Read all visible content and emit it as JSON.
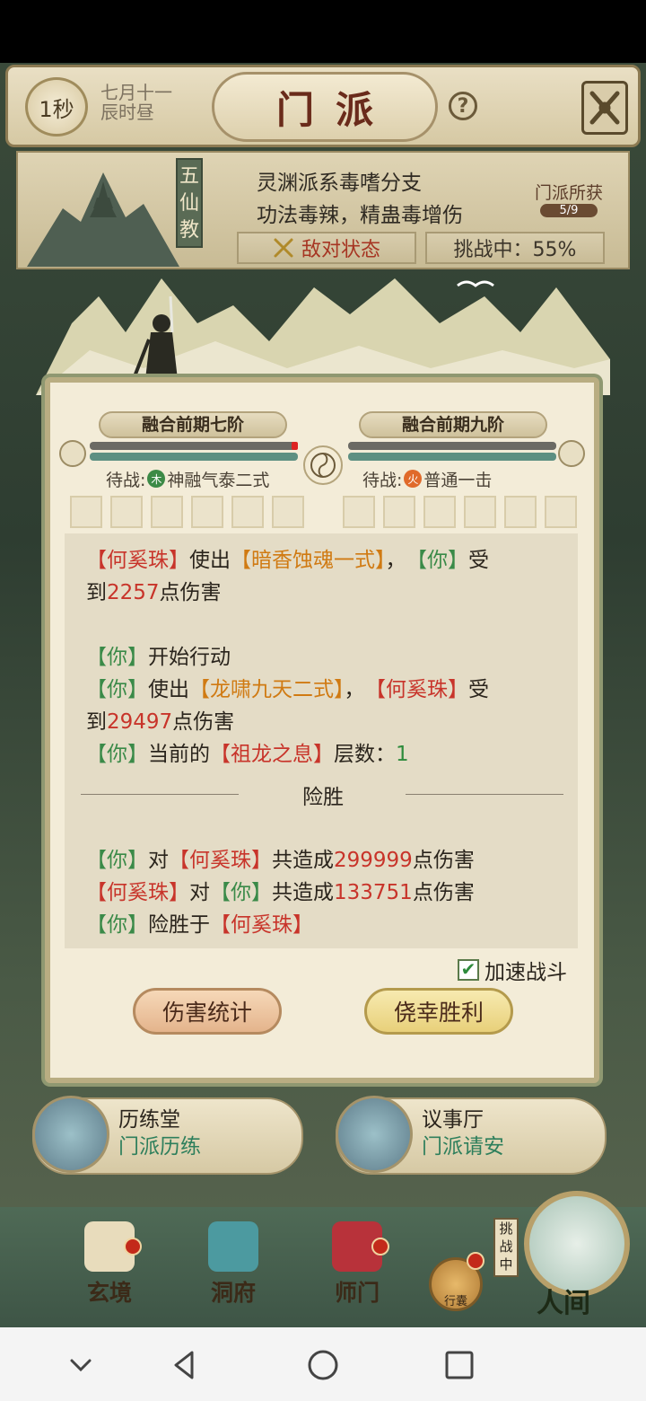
{
  "header": {
    "timer": "1秒",
    "date_line1": "七月十一",
    "date_line2": "辰时昼",
    "title": "门派",
    "help": "?"
  },
  "sect": {
    "badge": "五仙教",
    "desc_line1": "灵渊派系毒嗜分支",
    "desc_line2": "功法毒辣，精蛊毒增伤",
    "loot_label": "门派所获",
    "loot_count": "5/9",
    "hostile_label": "敌对状态",
    "challenge_label": "挑战中：55%"
  },
  "battle": {
    "left_rank": "融合前期七阶",
    "right_rank": "融合前期九阶",
    "left_pending_prefix": "待战:",
    "left_pending_element": "木",
    "left_pending_skill": "神融气泰二式",
    "right_pending_prefix": "待战:",
    "right_pending_element": "火",
    "right_pending_skill": "普通一击",
    "log": {
      "l1_a": "【何奚珠】",
      "l1_b": "使出",
      "l1_c": "【暗香蚀魂一式】",
      "l1_d": "，",
      "l1_e": "【你】",
      "l1_f": "受",
      "l2_a": "到",
      "l2_b": "2257",
      "l2_c": "点伤害",
      "l3_a": "【你】",
      "l3_b": "开始行动",
      "l4_a": "【你】",
      "l4_b": "使出",
      "l4_c": "【龙啸九天二式】",
      "l4_d": "，",
      "l4_e": "【何奚珠】",
      "l4_f": "受",
      "l5_a": "到",
      "l5_b": "29497",
      "l5_c": "点伤害",
      "l6_a": "【你】",
      "l6_b": "当前的",
      "l6_c": "【祖龙之息】",
      "l6_d": "层数：",
      "l6_e": "1",
      "divider": "险胜",
      "l7_a": "【你】",
      "l7_b": "对",
      "l7_c": "【何奚珠】",
      "l7_d": "共造成",
      "l7_e": "299999",
      "l7_f": "点伤害",
      "l8_a": "【何奚珠】",
      "l8_b": "对",
      "l8_c": "【你】",
      "l8_d": "共造成",
      "l8_e": "133751",
      "l8_f": "点伤害",
      "l9_a": "【你】",
      "l9_b": "险胜于",
      "l9_c": "【何奚珠】"
    },
    "speed_up_label": "加速战斗",
    "speed_up_checked": true,
    "btn_stats": "伤害统计",
    "btn_win": "侥幸胜利"
  },
  "halls": [
    {
      "name": "历练堂",
      "sub": "门派历练"
    },
    {
      "name": "议事厅",
      "sub": "门派请安"
    }
  ],
  "nav": {
    "xuan": "玄境",
    "dong": "洞府",
    "shi": "师门",
    "xing": "行囊",
    "ren_tag": "挑战中",
    "ren": "人间"
  },
  "colors": {
    "damage_red": "#c8342a",
    "player_green": "#2e8b3c",
    "skill_orange": "#d07a12"
  }
}
